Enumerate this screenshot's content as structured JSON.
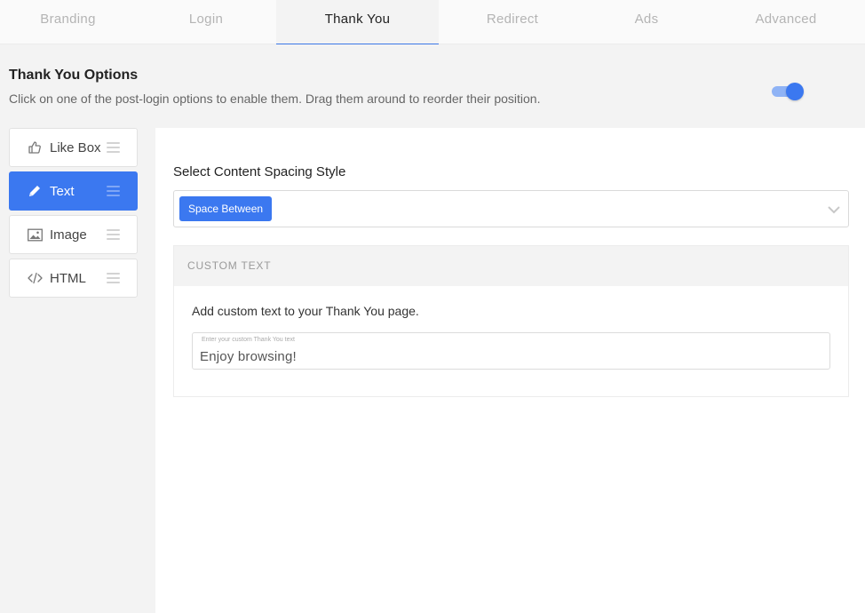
{
  "tabs": [
    {
      "label": "Branding",
      "active": false
    },
    {
      "label": "Login",
      "active": false
    },
    {
      "label": "Thank You",
      "active": true
    },
    {
      "label": "Redirect",
      "active": false
    },
    {
      "label": "Ads",
      "active": false
    },
    {
      "label": "Advanced",
      "active": false
    }
  ],
  "header": {
    "title": "Thank You Options",
    "description": "Click on one of the post-login options to enable them. Drag them around to reorder their position.",
    "toggle_on": true
  },
  "options": [
    {
      "label": "Like Box",
      "icon": "thumbs-up-icon",
      "active": false
    },
    {
      "label": "Text",
      "icon": "pencil-icon",
      "active": true
    },
    {
      "label": "Image",
      "icon": "image-icon",
      "active": false
    },
    {
      "label": "HTML",
      "icon": "code-icon",
      "active": false
    }
  ],
  "spacing": {
    "label": "Select Content Spacing Style",
    "selected": "Space Between"
  },
  "custom_text": {
    "heading": "CUSTOM TEXT",
    "description": "Add custom text to your Thank You page.",
    "placeholder": "Enter your custom Thank You text",
    "value": "Enjoy browsing!"
  },
  "colors": {
    "accent": "#3b78f0",
    "page_bg": "#f3f3f3",
    "panel_bg": "#ffffff"
  }
}
